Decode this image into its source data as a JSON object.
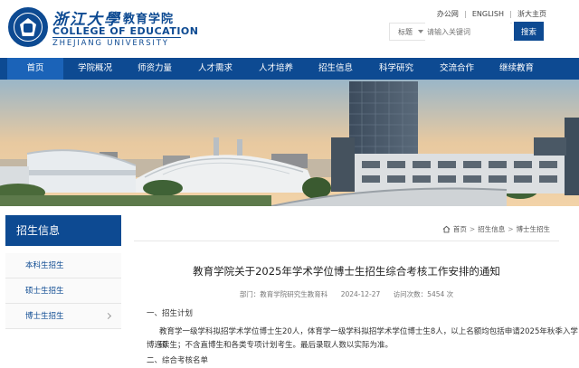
{
  "header": {
    "logo_cn": "浙江大學",
    "logo_cn_sub": "教育学院",
    "logo_en1": "COLLEGE OF EDUCATION",
    "logo_en2": "ZHEJIANG UNIVERSITY",
    "links": [
      "办公网",
      "ENGLISH",
      "浙大主页"
    ]
  },
  "search": {
    "select_label": "标题",
    "placeholder": "请输入关键词",
    "button": "搜索"
  },
  "nav": {
    "items": [
      "首页",
      "学院概况",
      "师资力量",
      "人才需求",
      "人才培养",
      "招生信息",
      "科学研究",
      "交流合作",
      "继续教育"
    ],
    "active": 0
  },
  "sidebar": {
    "title": "招生信息",
    "items": [
      "本科生招生",
      "硕士生招生",
      "博士生招生"
    ]
  },
  "breadcrumb": [
    "首页",
    "招生信息",
    "博士生招生"
  ],
  "article": {
    "title": "教育学院关于2025年学术学位博士生招生综合考核工作安排的通知",
    "dept": "部门：教育学院研究生教育科",
    "date": "2024-12-27",
    "views": "访问次数：5454 次",
    "section1": "一、招生计划",
    "para1_line1": "教育学一级学科拟招学术学位博士生20人，体育学一级学科拟招学术学位博士生8人，以上名额均包括申请2025年秋季入学硕",
    "para1_line2": "博连读生；不含直博生和各类专项计划考生。最后录取人数以实际为准。",
    "section2": "二、综合考核名单"
  },
  "colors": {
    "brand": "#0d4a92",
    "nav_active": "#1b63b8"
  }
}
